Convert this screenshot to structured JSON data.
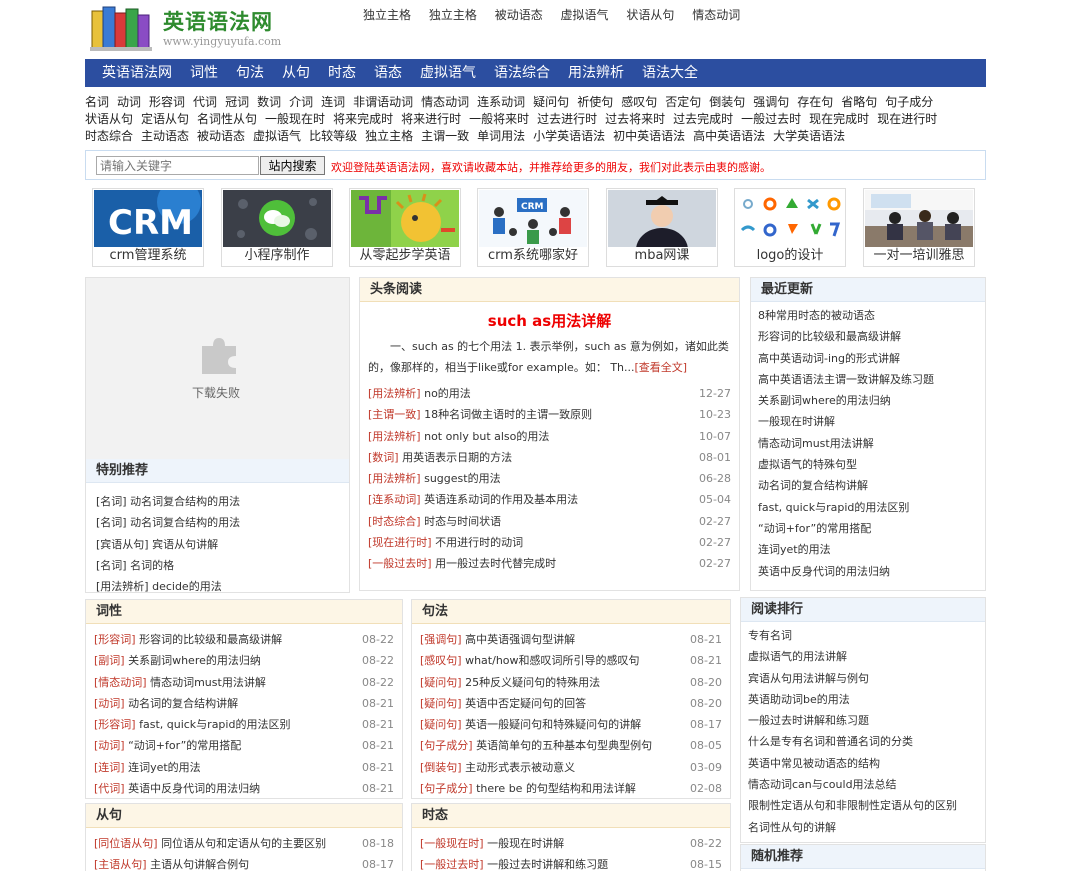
{
  "site": {
    "title": "英语语法网",
    "url": "www.yingyuyufa.com"
  },
  "top_links": [
    "独立主格",
    "独立主格",
    "被动语态",
    "虚拟语气",
    "状语从句",
    "情态动词"
  ],
  "nav": [
    "英语语法网",
    "词性",
    "句法",
    "从句",
    "时态",
    "语态",
    "虚拟语气",
    "语法综合",
    "用法辨析",
    "语法大全"
  ],
  "tag_rows": [
    [
      "名词",
      "动词",
      "形容词",
      "代词",
      "冠词",
      "数词",
      "介词",
      "连词",
      "非谓语动词",
      "情态动词",
      "连系动词",
      "疑问句",
      "祈使句",
      "感叹句",
      "否定句",
      "倒装句",
      "强调句",
      "存在句",
      "省略句",
      "句子成分"
    ],
    [
      "状语从句",
      "定语从句",
      "名词性从句",
      "一般现在时",
      "将来完成时",
      "将来进行时",
      "一般将来时",
      "过去进行时",
      "过去将来时",
      "过去完成时",
      "一般过去时",
      "现在完成时",
      "现在进行时"
    ],
    [
      "时态综合",
      "主动语态",
      "被动语态",
      "虚拟语气",
      "比较等级",
      "独立主格",
      "主谓一致",
      "单词用法",
      "小学英语语法",
      "初中英语语法",
      "高中英语语法",
      "大学英语语法"
    ]
  ],
  "search": {
    "placeholder": "请输入关键字",
    "button": "站内搜索",
    "welcome": "欢迎登陆英语语法网，喜欢请收藏本站，并推荐给更多的朋友，我们对此表示由衷的感谢。"
  },
  "pics": [
    {
      "caption": "crm管理系统",
      "icon": "crm-logo"
    },
    {
      "caption": "小程序制作",
      "icon": "wechat-icon"
    },
    {
      "caption": "从零起步学英语",
      "icon": "hedgehog-illustration"
    },
    {
      "caption": "crm系统哪家好",
      "icon": "crm-people-illustration"
    },
    {
      "caption": "mba网课",
      "icon": "graduate-photo"
    },
    {
      "caption": "logo的设计",
      "icon": "logo-shapes"
    },
    {
      "caption": "一对一培训雅思",
      "icon": "training-photo"
    }
  ],
  "special": {
    "fail_text": "下载失败",
    "header": "特别推荐",
    "items": [
      {
        "cat": "名词",
        "text": "动名词复合结构的用法"
      },
      {
        "cat": "名词",
        "text": "动名词复合结构的用法"
      },
      {
        "cat": "宾语从句",
        "text": "宾语从句讲解"
      },
      {
        "cat": "名词",
        "text": "名词的格"
      },
      {
        "cat": "用法辨析",
        "text": "decide的用法"
      }
    ]
  },
  "headline": {
    "header": "头条阅读",
    "title": "such as用法详解",
    "summary": "一、such as 的七个用法 1. 表示举例，such as 意为例如，诸如此类的，像那样的，相当于like或for example。如： Th...",
    "more": "[查看全文]",
    "items": [
      {
        "cat": "用法辨析",
        "text": "no的用法",
        "date": "12-27"
      },
      {
        "cat": "主谓一致",
        "text": "18种名词做主语时的主谓一致原则",
        "date": "10-23"
      },
      {
        "cat": "用法辨析",
        "text": "not only but also的用法",
        "date": "10-07"
      },
      {
        "cat": "数词",
        "text": "用英语表示日期的方法",
        "date": "08-01"
      },
      {
        "cat": "用法辨析",
        "text": "suggest的用法",
        "date": "06-28"
      },
      {
        "cat": "连系动词",
        "text": "英语连系动词的作用及基本用法",
        "date": "05-04"
      },
      {
        "cat": "时态综合",
        "text": "时态与时间状语",
        "date": "02-27"
      },
      {
        "cat": "现在进行时",
        "text": "不用进行时的动词",
        "date": "02-27"
      },
      {
        "cat": "一般过去时",
        "text": "用一般过去时代替完成时",
        "date": "02-27"
      }
    ]
  },
  "latest": {
    "header": "最近更新",
    "items": [
      "8种常用时态的被动语态",
      "形容词的比较级和最高级讲解",
      "高中英语动词-ing的形式讲解",
      "高中英语语法主谓一致讲解及练习题",
      "关系副词where的用法归纳",
      "一般现在时讲解",
      "情态动词must用法讲解",
      "虚拟语气的特殊句型",
      "动名词的复合结构讲解",
      "fast, quick与rapid的用法区别",
      "“动词+for”的常用搭配",
      "连词yet的用法",
      "英语中反身代词的用法归纳"
    ]
  },
  "cixing": {
    "header": "词性",
    "items": [
      {
        "cat": "形容词",
        "text": "形容词的比较级和最高级讲解",
        "date": "08-22"
      },
      {
        "cat": "副词",
        "text": "关系副词where的用法归纳",
        "date": "08-22"
      },
      {
        "cat": "情态动词",
        "text": "情态动词must用法讲解",
        "date": "08-22"
      },
      {
        "cat": "动词",
        "text": "动名词的复合结构讲解",
        "date": "08-21"
      },
      {
        "cat": "形容词",
        "text": "fast, quick与rapid的用法区别",
        "date": "08-21"
      },
      {
        "cat": "动词",
        "text": "“动词+for”的常用搭配",
        "date": "08-21"
      },
      {
        "cat": "连词",
        "text": "连词yet的用法",
        "date": "08-21"
      },
      {
        "cat": "代词",
        "text": "英语中反身代词的用法归纳",
        "date": "08-21"
      }
    ]
  },
  "jufa": {
    "header": "句法",
    "items": [
      {
        "cat": "强调句",
        "text": "高中英语强调句型讲解",
        "date": "08-21"
      },
      {
        "cat": "感叹句",
        "text": "what/how和感叹词所引导的感叹句",
        "date": "08-21"
      },
      {
        "cat": "疑问句",
        "text": "25种反义疑问句的特殊用法",
        "date": "08-20"
      },
      {
        "cat": "疑问句",
        "text": "英语中否定疑问句的回答",
        "date": "08-20"
      },
      {
        "cat": "疑问句",
        "text": "英语一般疑问句和特殊疑问句的讲解",
        "date": "08-17"
      },
      {
        "cat": "句子成分",
        "text": "英语简单句的五种基本句型典型例句",
        "date": "08-05"
      },
      {
        "cat": "倒装句",
        "text": "主动形式表示被动意义",
        "date": "03-09"
      },
      {
        "cat": "句子成分",
        "text": "there be 的句型结构和用法详解",
        "date": "02-08"
      }
    ]
  },
  "reading_rank": {
    "header": "阅读排行",
    "items": [
      "专有名词",
      "虚拟语气的用法讲解",
      "宾语从句用法讲解与例句",
      "英语助动词be的用法",
      "一般过去时讲解和练习题",
      "什么是专有名词和普通名词的分类",
      "英语中常见被动语态的结构",
      "情态动词can与could用法总结",
      "限制性定语从句和非限制性定语从句的区别",
      "名词性从句的讲解"
    ]
  },
  "congju": {
    "header": "从句",
    "items": [
      {
        "cat": "同位语从句",
        "text": "同位语从句和定语从句的主要区别",
        "date": "08-18"
      },
      {
        "cat": "主语从句",
        "text": "主语从句讲解合例句",
        "date": "08-17"
      }
    ]
  },
  "shitai": {
    "header": "时态",
    "items": [
      {
        "cat": "一般现在时",
        "text": "一般现在时讲解",
        "date": "08-22"
      },
      {
        "cat": "一般过去时",
        "text": "一般过去时讲解和练习题",
        "date": "08-15"
      }
    ]
  },
  "random": {
    "header": "随机推荐"
  }
}
